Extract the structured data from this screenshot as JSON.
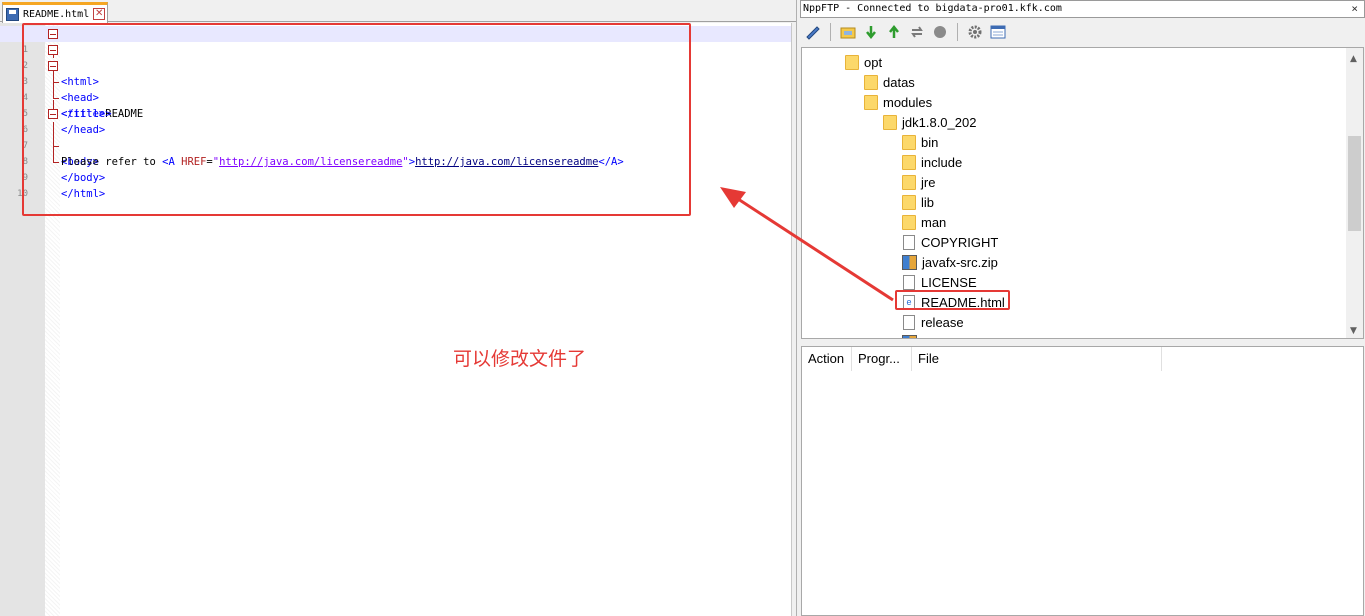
{
  "editor": {
    "tab_label": "README.html",
    "close_glyph": "✕",
    "lines": [
      {
        "n": "1"
      },
      {
        "n": "2"
      },
      {
        "n": "3"
      },
      {
        "n": "4"
      },
      {
        "n": "5"
      },
      {
        "n": "6"
      },
      {
        "n": "7"
      },
      {
        "n": "8"
      },
      {
        "n": "9"
      },
      {
        "n": "10"
      }
    ],
    "code": {
      "l1": "<html>",
      "l2": "<head>",
      "l3_tag": "<title>",
      "l3_text": "README",
      "l4": "</title>",
      "l5": "</head>",
      "l6": "<body>",
      "l7_text": "Please refer to ",
      "l7_tag_open": "<A ",
      "l7_attr": "HREF",
      "l7_eq": "=",
      "l7_q1": "\"",
      "l7_val": "http://java.com/licensereadme",
      "l7_q2": "\"",
      "l7_gt": ">",
      "l7_link": "http://java.com/licensereadme",
      "l7_close": "</A>",
      "l8": "</body>",
      "l9": "</html>"
    }
  },
  "annotation_text": "可以修改文件了",
  "ftp": {
    "title": "NppFTP - Connected to bigdata-pro01.kfk.com",
    "close_glyph": "×",
    "tree": {
      "opt": "opt",
      "datas": "datas",
      "modules": "modules",
      "jdk": "jdk1.8.0_202",
      "bin": "bin",
      "include": "include",
      "jre": "jre",
      "lib": "lib",
      "man": "man",
      "copyright": "COPYRIGHT",
      "javafx": "javafx-src.zip",
      "license": "LICENSE",
      "readme": "README.html",
      "release": "release"
    },
    "queue_columns": {
      "action": "Action",
      "progress": "Progr...",
      "file": "File"
    }
  },
  "colors": {
    "annotation_red": "#e53935",
    "tag_blue": "#0000ff",
    "folder_yellow": "#fcd86a"
  }
}
